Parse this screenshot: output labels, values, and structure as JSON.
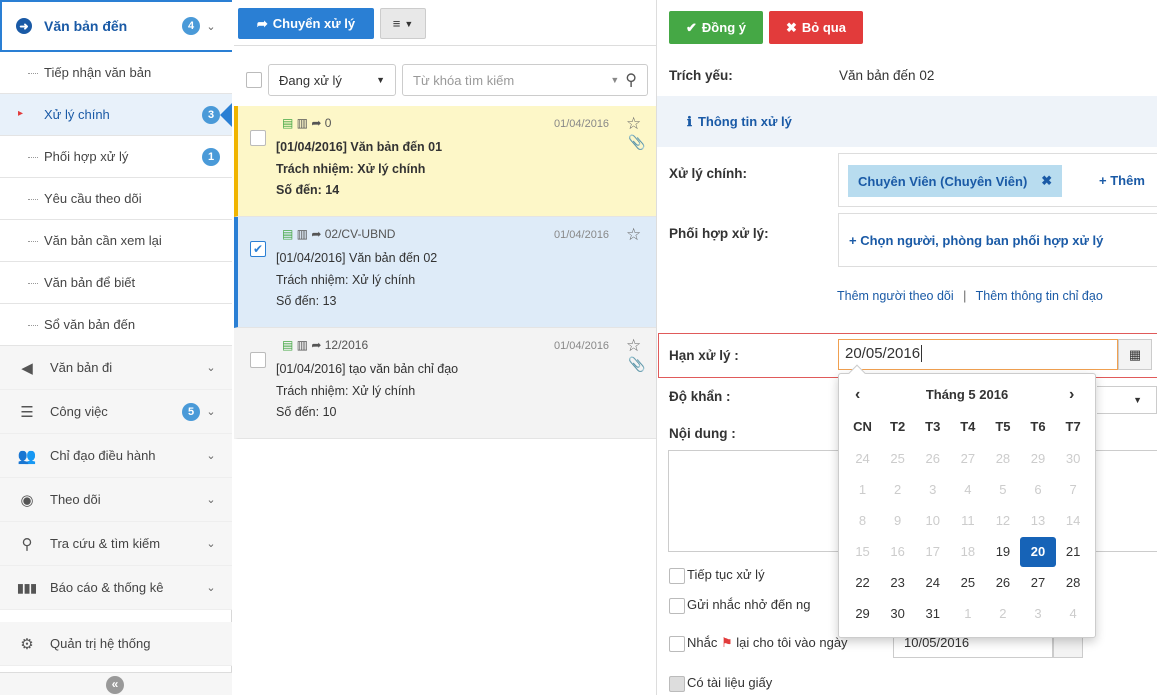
{
  "sidebar": {
    "header": {
      "label": "Văn bản đến",
      "count": "4"
    },
    "sub_items": [
      {
        "label": "Tiếp nhận văn bản",
        "badge": ""
      },
      {
        "label": "Xử lý chính",
        "badge": "3"
      },
      {
        "label": "Phối hợp xử lý",
        "badge": "1"
      },
      {
        "label": "Yêu cầu theo dõi",
        "badge": ""
      },
      {
        "label": "Văn bản cần xem lại",
        "badge": ""
      },
      {
        "label": "Văn bản để biết",
        "badge": ""
      },
      {
        "label": "Sổ văn bản đến",
        "badge": ""
      }
    ],
    "menus": [
      {
        "label": "Văn bản đi",
        "badge": "",
        "icon": "arrow-left-circle-icon"
      },
      {
        "label": "Công việc",
        "badge": "5",
        "icon": "tasks-icon"
      },
      {
        "label": "Chỉ đạo điều hành",
        "badge": "",
        "icon": "users-icon"
      },
      {
        "label": "Theo dõi",
        "badge": "",
        "icon": "eye-icon"
      },
      {
        "label": "Tra cứu & tìm kiếm",
        "badge": "",
        "icon": "search-icon"
      },
      {
        "label": "Báo cáo & thống kê",
        "badge": "",
        "icon": "bar-chart-icon"
      },
      {
        "label": "Quản trị hệ thống",
        "badge": "",
        "icon": "gears-icon"
      }
    ],
    "collapse_glyph": "«"
  },
  "middle": {
    "forward_label": "Chuyển xử lý",
    "filter_value": "Đang xử lý",
    "search_placeholder": "Từ khóa tìm kiếm",
    "items": [
      {
        "code": "0",
        "date": "01/04/2016",
        "title": "[01/04/2016] Văn bản đến 01",
        "resp": "Trách nhiệm: Xử lý chính",
        "num": "Số đến: 14"
      },
      {
        "code": "02/CV-UBND",
        "date": "01/04/2016",
        "title": "[01/04/2016] Văn bản đến 02",
        "resp": "Trách nhiệm: Xử lý chính",
        "num": "Số đến: 13"
      },
      {
        "code": "12/2016",
        "date": "01/04/2016",
        "title": "[01/04/2016] tạo văn bản chỉ đạo",
        "resp": "Trách nhiệm: Xử lý chính",
        "num": "Số đến: 10"
      }
    ]
  },
  "right": {
    "ok_label": "Đồng ý",
    "cancel_label": "Bỏ qua",
    "summary_label": "Trích yếu:",
    "summary_value": "Văn bản đến 02",
    "info_label": "Thông tin xử lý",
    "main_label": "Xử lý chính:",
    "main_tag": "Chuyên Viên (Chuyên Viên)",
    "add_label": "+ Thêm",
    "coop_label": "Phối hợp xử lý:",
    "coop_placeholder": "+ Chọn người, phòng ban phối hợp xử lý",
    "add_watcher": "Thêm người theo dõi",
    "sep": "|",
    "add_guide": "Thêm thông tin chỉ đạo",
    "deadline_label": "Hạn xử lý :",
    "deadline_value": "20/05/2016",
    "urgency_label": "Độ khẩn :",
    "content_label": "Nội dung :",
    "continue_label": "Tiếp tục xử lý",
    "remind_label": "Gửi nhắc nhở đến ng",
    "remind_me_a": "Nhắc",
    "remind_me_b": "lại cho tôi vào ngày",
    "remind_date_value": "10/05/2016",
    "paper_label": "Có tài liệu giấy"
  },
  "calendar": {
    "prev": "‹",
    "next": "›",
    "month_label": "Tháng 5 2016",
    "weekdays": [
      "CN",
      "T2",
      "T3",
      "T4",
      "T5",
      "T6",
      "T7"
    ],
    "weeks": [
      [
        "24",
        "25",
        "26",
        "27",
        "28",
        "29",
        "30"
      ],
      [
        "1",
        "2",
        "3",
        "4",
        "5",
        "6",
        "7"
      ],
      [
        "8",
        "9",
        "10",
        "11",
        "12",
        "13",
        "14"
      ],
      [
        "15",
        "16",
        "17",
        "18",
        "19",
        "20",
        "21"
      ],
      [
        "22",
        "23",
        "24",
        "25",
        "26",
        "27",
        "28"
      ],
      [
        "29",
        "30",
        "31",
        "1",
        "2",
        "3",
        "4"
      ]
    ],
    "selected": "20"
  },
  "colors": {
    "primary": "#2a7fd4",
    "ok": "#45a845",
    "cancel": "#e23b3b",
    "highlight_yellow": "#fdf7c8",
    "highlight_blue": "#deebf8",
    "selected_day": "#1663b7",
    "flag": "#e23b3b"
  }
}
